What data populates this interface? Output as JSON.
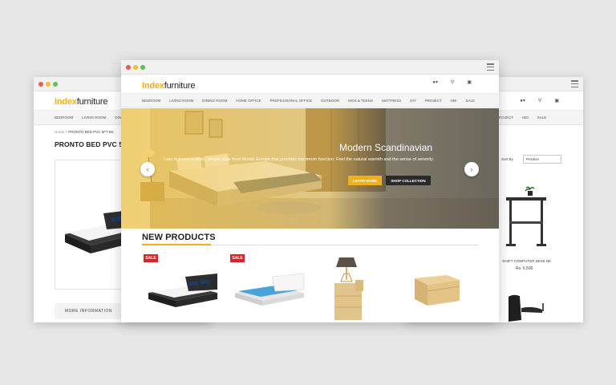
{
  "brand": {
    "logo_bold": "Index",
    "logo_rest": "furniture",
    "accent": "#f4ad1b"
  },
  "left_window": {
    "nav": [
      "BEDROOM",
      "LIVING ROOM",
      "DINI"
    ],
    "breadcrumb": {
      "home": "Home",
      "separator": ">",
      "current": "PRONTO BED PVC 5FT BK"
    },
    "product_title": "PRONTO BED PVC 5FT",
    "more_info": "MORE INFORMATION"
  },
  "right_window": {
    "nav": [
      "ROJECT",
      "HDI",
      "SALE"
    ],
    "sort_label": "Sort By",
    "sort_value": "Position",
    "product_name": "-SHIFT COMPUTER DESK BK",
    "product_price": "Rs. 6,590"
  },
  "front_window": {
    "nav": [
      "BEDROOM",
      "LIVING ROOM",
      "DINING ROOM",
      "HOME OFFICE",
      "PROFESSIONAL OFFICE",
      "OUTDOOR",
      "KIDS & TEENS",
      "MATTRESS",
      "DIY",
      "PROJECT",
      "HDI",
      "SALE"
    ],
    "header_icons": [
      "user-icon",
      "search-icon",
      "cart-icon"
    ],
    "hero": {
      "title": "Modern Scandinavian",
      "text": "Less is more! A clean, simple style from Nordic Europe that provides maximum function. Feel the natural warmth and the sense of serenity.",
      "learn_more": "LEARN MORE",
      "shop_collection": "SHOP COLLECTION"
    },
    "new_products": {
      "title": "NEW PRODUCTS",
      "sale_badge": "SALE",
      "items": [
        "black-bed",
        "white-bed",
        "lamp-nightstand",
        "wood-chest"
      ]
    }
  }
}
